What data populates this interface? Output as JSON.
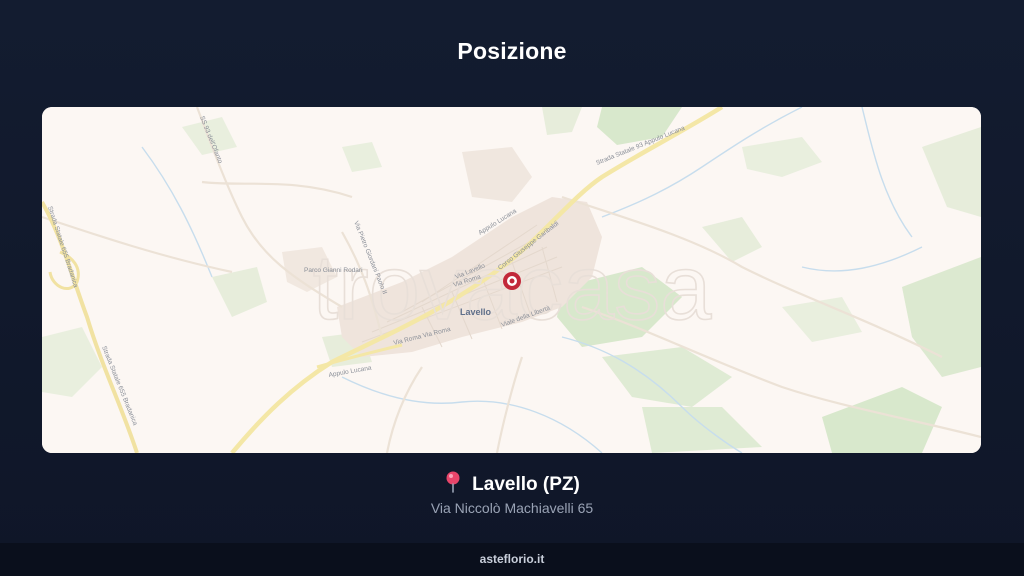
{
  "header": {
    "title": "Posizione"
  },
  "map": {
    "watermark": "trovacasa",
    "town_label": "Lavello",
    "road_labels": [
      "Strada Statale 93 Appulo Lucana",
      "Appulo Lucana",
      "Via Roma",
      "Via Roma Via Roma",
      "Viale della Libertà",
      "Via Pietro Giordani Paolo II",
      "Strada Statale 655 Bradanica",
      "Strada Statale 655 Bradanica",
      "SS 93 dell'Ofanto",
      "Via Lavello",
      "Corso Giuseppe Garibaldi",
      "Parco Gianni Rodari",
      "Appulo Lucana"
    ],
    "marker_icon": "location-marker-icon",
    "colors": {
      "land": "#fcf7f3",
      "urban": "#efe6df",
      "green": "#cfe3c3",
      "highway": "#f4e7a6",
      "water": "#c3dcec",
      "marker": "#c2283a"
    }
  },
  "location": {
    "pin_icon": "map-pin-icon",
    "city": "Lavello (PZ)",
    "address": "Via Niccolò Machiavelli 65"
  },
  "footer": {
    "site": "asteflorio.it"
  }
}
